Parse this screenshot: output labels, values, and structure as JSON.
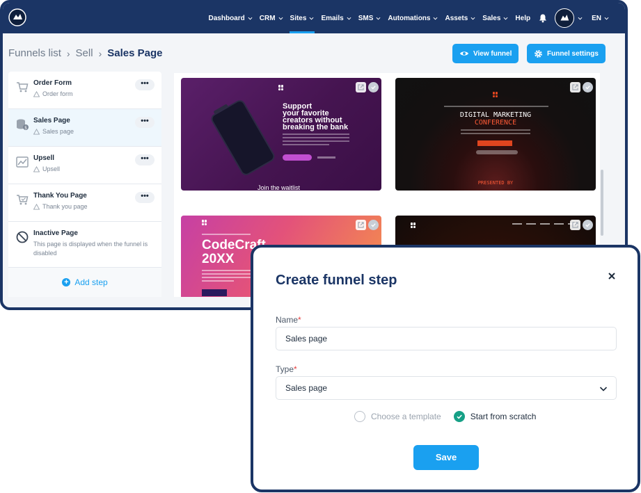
{
  "topbar": {
    "nav": [
      {
        "label": "Dashboard",
        "has_menu": true
      },
      {
        "label": "CRM",
        "has_menu": true
      },
      {
        "label": "Sites",
        "has_menu": true,
        "active": true
      },
      {
        "label": "Emails",
        "has_menu": true
      },
      {
        "label": "SMS",
        "has_menu": true
      },
      {
        "label": "Automations",
        "has_menu": true
      },
      {
        "label": "Assets",
        "has_menu": true
      },
      {
        "label": "Sales",
        "has_menu": true
      },
      {
        "label": "Help",
        "has_menu": false
      }
    ],
    "language": "EN",
    "icons": [
      "logo-icon",
      "bell-icon",
      "avatar"
    ]
  },
  "breadcrumb": {
    "items": [
      "Funnels list",
      "Sell"
    ],
    "current": "Sales Page"
  },
  "actions": {
    "view_funnel": "View funnel",
    "funnel_settings": "Funnel settings"
  },
  "steps": [
    {
      "title": "Order Form",
      "sub": "Order form",
      "icon": "cart-icon"
    },
    {
      "title": "Sales Page",
      "sub": "Sales page",
      "icon": "coins-icon",
      "selected": true
    },
    {
      "title": "Upsell",
      "sub": "Upsell",
      "icon": "chart-icon"
    },
    {
      "title": "Thank You Page",
      "sub": "Thank you page",
      "icon": "cart-check-icon"
    }
  ],
  "inactive_step": {
    "title": "Inactive Page",
    "sub": "This page is displayed when the funnel is disabled"
  },
  "add_step": "Add step",
  "templates": {
    "t1": {
      "title_lines": [
        "Support",
        "your favorite",
        "creators without",
        "breaking the bank"
      ],
      "footer": "Join the waitlist"
    },
    "t2": {
      "title_line1": "DIGITAL MARKETING",
      "title_line2": "CONFERENCE",
      "presented": "PRESENTED BY"
    },
    "t3": {
      "title_line1": "CodeCraft",
      "title_line2": "20XX"
    }
  },
  "modal": {
    "title": "Create funnel step",
    "name_label": "Name",
    "name_value": "Sales page",
    "type_label": "Type",
    "type_value": "Sales page",
    "option_template": "Choose a template",
    "option_scratch": "Start from scratch",
    "save": "Save"
  },
  "colors": {
    "navy": "#1b3565",
    "accent": "#1aa0f0",
    "success": "#16a086",
    "required": "#e53e3e"
  }
}
